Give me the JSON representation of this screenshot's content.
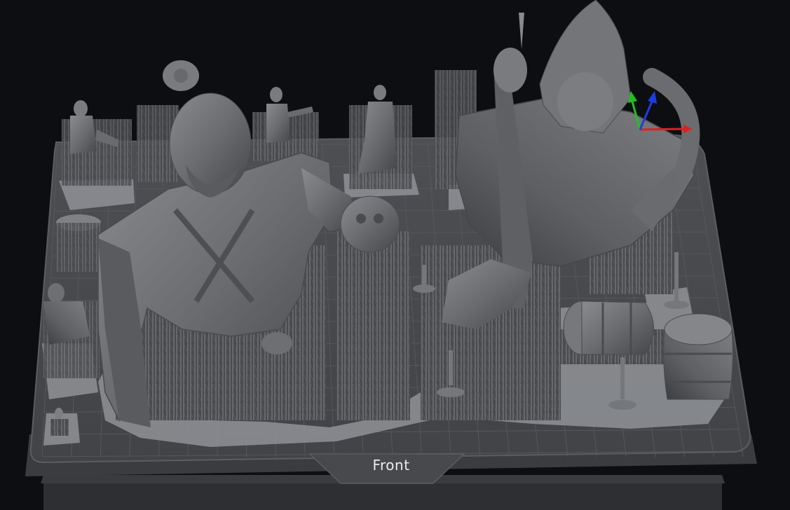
{
  "viewport": {
    "orientation_label": "Front",
    "colors": {
      "background": "#0d0e12",
      "plate_top": "#4a4b4e",
      "plate_side": "#38393c",
      "grid_line": "#5a5b5f",
      "raft": "#8e9094",
      "model": "#6a6b6f",
      "model_shadow": "#3f4043",
      "axis_x": "#e0201e",
      "axis_y": "#22c21e",
      "axis_z": "#1e3de0"
    }
  }
}
